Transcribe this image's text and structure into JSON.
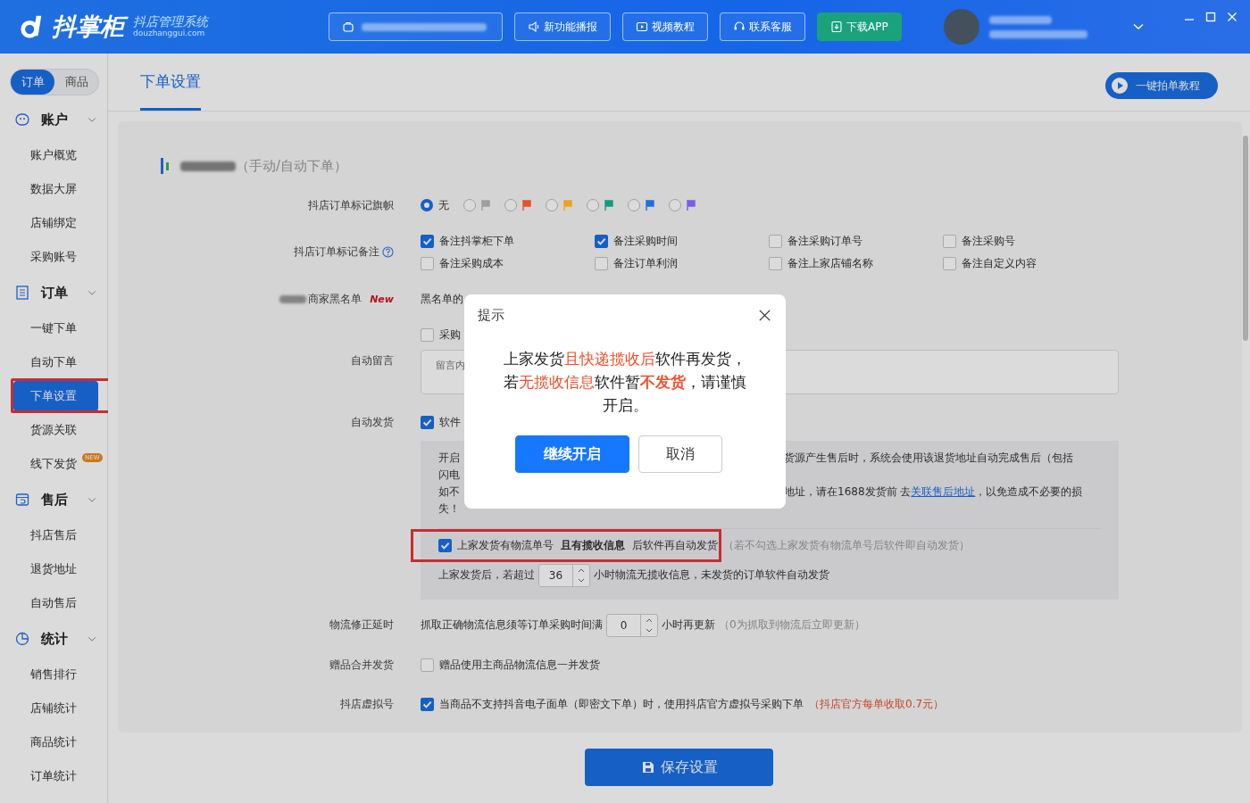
{
  "header": {
    "logo": "抖掌柜",
    "logo_subtitle": "抖店管理系统",
    "logo_domain": "douzhanggui.com",
    "buttons": [
      {
        "label": "新功能播报",
        "kind": "news"
      },
      {
        "label": "视频教程",
        "kind": "video"
      },
      {
        "label": "联系客服",
        "kind": "service"
      },
      {
        "label": "下载APP",
        "kind": "download"
      }
    ]
  },
  "sidebar": {
    "segments": [
      {
        "label": "订单",
        "selected": true
      },
      {
        "label": "商品",
        "selected": false
      }
    ],
    "groups": [
      {
        "title": "账户",
        "items": [
          {
            "label": "账户概览",
            "selected": false
          },
          {
            "label": "数据大屏",
            "selected": false
          },
          {
            "label": "店铺绑定",
            "selected": false
          },
          {
            "label": "采购账号",
            "selected": false
          }
        ]
      },
      {
        "title": "订单",
        "items": [
          {
            "label": "一键下单",
            "selected": false
          },
          {
            "label": "自动下单",
            "selected": false
          },
          {
            "label": "下单设置",
            "selected": true
          },
          {
            "label": "货源关联",
            "selected": false
          },
          {
            "label": "线下发货",
            "selected": false,
            "badge": "NEW"
          }
        ]
      },
      {
        "title": "售后",
        "items": [
          {
            "label": "抖店售后",
            "selected": false
          },
          {
            "label": "退货地址",
            "selected": false
          },
          {
            "label": "自动售后",
            "selected": false
          }
        ]
      },
      {
        "title": "统计",
        "items": [
          {
            "label": "销售排行",
            "selected": false
          },
          {
            "label": "店铺统计",
            "selected": false
          },
          {
            "label": "商品统计",
            "selected": false
          },
          {
            "label": "订单统计",
            "selected": false
          }
        ]
      }
    ]
  },
  "tabs": [
    {
      "label": "下单设置",
      "selected": true
    }
  ],
  "tutorial_button": "一键拍单教程",
  "section_title": "（手动/自动下单）",
  "flag_row": {
    "label": "抖店订单标记旗帜",
    "options": [
      {
        "label": "无",
        "selected": true
      },
      {
        "color": "#9e9e9e",
        "selected": false
      },
      {
        "color": "#e8502a",
        "selected": false
      },
      {
        "color": "#f0a01e",
        "selected": false
      },
      {
        "color": "#139a83",
        "selected": false
      },
      {
        "color": "#1e6fe0",
        "selected": false
      },
      {
        "color": "#7b5ce6",
        "selected": false
      }
    ]
  },
  "remark_row": {
    "label": "抖店订单标记备注",
    "options": [
      {
        "label": "备注抖掌柜下单",
        "checked": true
      },
      {
        "label": "备注采购时间",
        "checked": true
      },
      {
        "label": "备注采购订单号",
        "checked": false
      },
      {
        "label": "备注采购号",
        "checked": false
      },
      {
        "label": "备注采购成本",
        "checked": false
      },
      {
        "label": "备注订单利润",
        "checked": false
      },
      {
        "label": "备注上家店铺名称",
        "checked": false
      },
      {
        "label": "备注自定义内容",
        "checked": false
      }
    ]
  },
  "blacklist_row": {
    "label": "商家黑名单",
    "badge": "New",
    "text": "黑名单的"
  },
  "message_row": {
    "label": "自动留言",
    "option": {
      "label": "采购",
      "checked": false
    },
    "placeholder": "留言内"
  },
  "ship_row": {
    "label": "自动发货",
    "option": {
      "label": "软件",
      "checked": true
    },
    "notice_left": [
      "开启",
      "闪电",
      "如不",
      "失！"
    ],
    "notice_right_1": "货源产生售后时，系统会使用该退货地址自动完成售后（包括",
    "notice_right_3_before": "地址，请在1688发货前 去",
    "notice_link": "关联售后地址",
    "notice_right_3_after": "，以免造成不必要的损",
    "collect_option": {
      "label": "上家发货有物流单号 **且有揽收信息** 后软件再自动发货",
      "checked": true,
      "hint": "（若不勾选上家发货有物流单号后软件即自动发货）"
    },
    "timeout_before": "上家发货后，若超过",
    "timeout_value": "36",
    "timeout_after": "小时物流无揽收信息，未发货的订单软件自动发货"
  },
  "delay_row": {
    "label": "物流修正延时",
    "before": "抓取正确物流信息须等订单采购时间满",
    "value": "0",
    "after": "小时再更新",
    "hint": "（0为抓取到物流后立即更新）"
  },
  "gift_row": {
    "label": "赠品合并发货",
    "option": {
      "label": "赠品使用主商品物流信息一并发货",
      "checked": false
    }
  },
  "virtual_row": {
    "label": "抖店虚拟号",
    "option": {
      "label": "当商品不支持抖音电子面单（即密文下单）时，使用抖店官方虚拟号采购下单",
      "checked": true
    },
    "note": "（抖店官方每单收取0.7元）"
  },
  "save_button": "保存设置",
  "dialog": {
    "title": "提示",
    "message": [
      {
        "text": "上家发货",
        "kind": "plain"
      },
      {
        "text": "且快递揽收后",
        "kind": "highlight"
      },
      {
        "text": "软件再发货，若",
        "kind": "plain"
      },
      {
        "text": "无揽收信息",
        "kind": "highlight"
      },
      {
        "text": "软件暂",
        "kind": "plain"
      },
      {
        "text": "不发货",
        "kind": "strong"
      },
      {
        "text": "，请谨慎开启。",
        "kind": "plain"
      }
    ],
    "buttons": [
      {
        "label": "继续开启",
        "kind": "primary"
      },
      {
        "label": "取消",
        "kind": "default"
      }
    ]
  }
}
